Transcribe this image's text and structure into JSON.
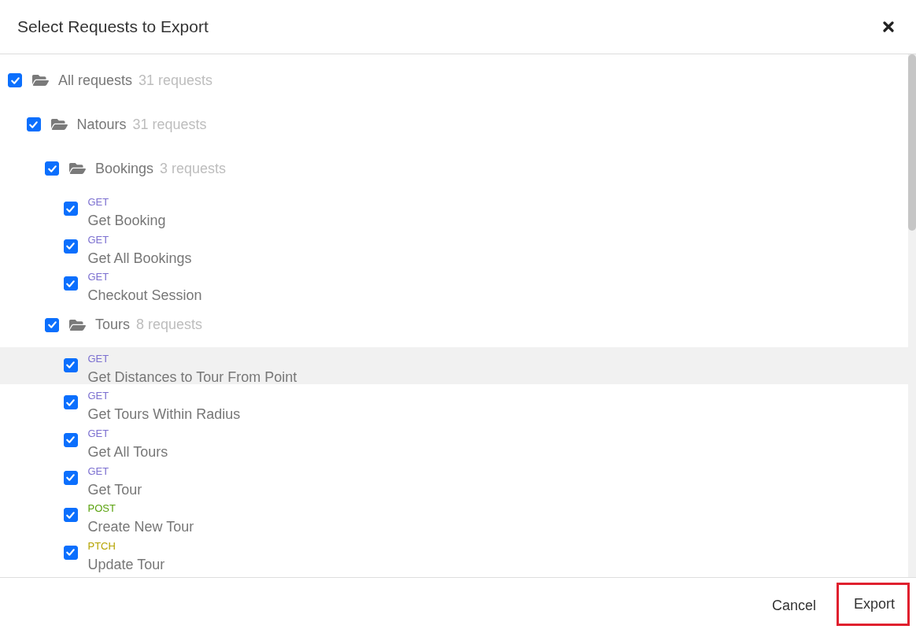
{
  "dialog": {
    "title": "Select Requests to Export"
  },
  "tree": [
    {
      "kind": "folder",
      "name": "All requests",
      "count": "31 requests",
      "checked": true,
      "expanded": true,
      "children": [
        {
          "kind": "folder",
          "name": "Natours",
          "count": "31 requests",
          "checked": true,
          "expanded": true,
          "children": [
            {
              "kind": "folder",
              "name": "Bookings",
              "count": "3 requests",
              "checked": true,
              "expanded": true,
              "children": [
                {
                  "kind": "request",
                  "method": "GET",
                  "color": "#7b6fd0",
                  "name": "Get Booking",
                  "checked": true,
                  "hovered": false
                },
                {
                  "kind": "request",
                  "method": "GET",
                  "color": "#7b6fd0",
                  "name": "Get All Bookings",
                  "checked": true,
                  "hovered": false
                },
                {
                  "kind": "request",
                  "method": "GET",
                  "color": "#7b6fd0",
                  "name": "Checkout Session",
                  "checked": true,
                  "hovered": false
                }
              ]
            },
            {
              "kind": "folder",
              "name": "Tours",
              "count": "8 requests",
              "checked": true,
              "expanded": true,
              "children": [
                {
                  "kind": "request",
                  "method": "GET",
                  "color": "#7b6fd0",
                  "name": "Get Distances to Tour From Point",
                  "checked": true,
                  "hovered": true
                },
                {
                  "kind": "request",
                  "method": "GET",
                  "color": "#7b6fd0",
                  "name": "Get Tours Within Radius",
                  "checked": true,
                  "hovered": false
                },
                {
                  "kind": "request",
                  "method": "GET",
                  "color": "#7b6fd0",
                  "name": "Get All Tours",
                  "checked": true,
                  "hovered": false
                },
                {
                  "kind": "request",
                  "method": "GET",
                  "color": "#7b6fd0",
                  "name": "Get Tour",
                  "checked": true,
                  "hovered": false
                },
                {
                  "kind": "request",
                  "method": "POST",
                  "color": "#5aa20e",
                  "name": "Create New Tour",
                  "checked": true,
                  "hovered": false
                },
                {
                  "kind": "request",
                  "method": "PTCH",
                  "color": "#b5a300",
                  "name": "Update Tour",
                  "checked": true,
                  "hovered": false
                }
              ]
            }
          ]
        }
      ]
    }
  ],
  "footer": {
    "buttons": [
      {
        "label": "Cancel",
        "highlighted": false
      },
      {
        "label": "Export",
        "highlighted": true
      }
    ]
  }
}
